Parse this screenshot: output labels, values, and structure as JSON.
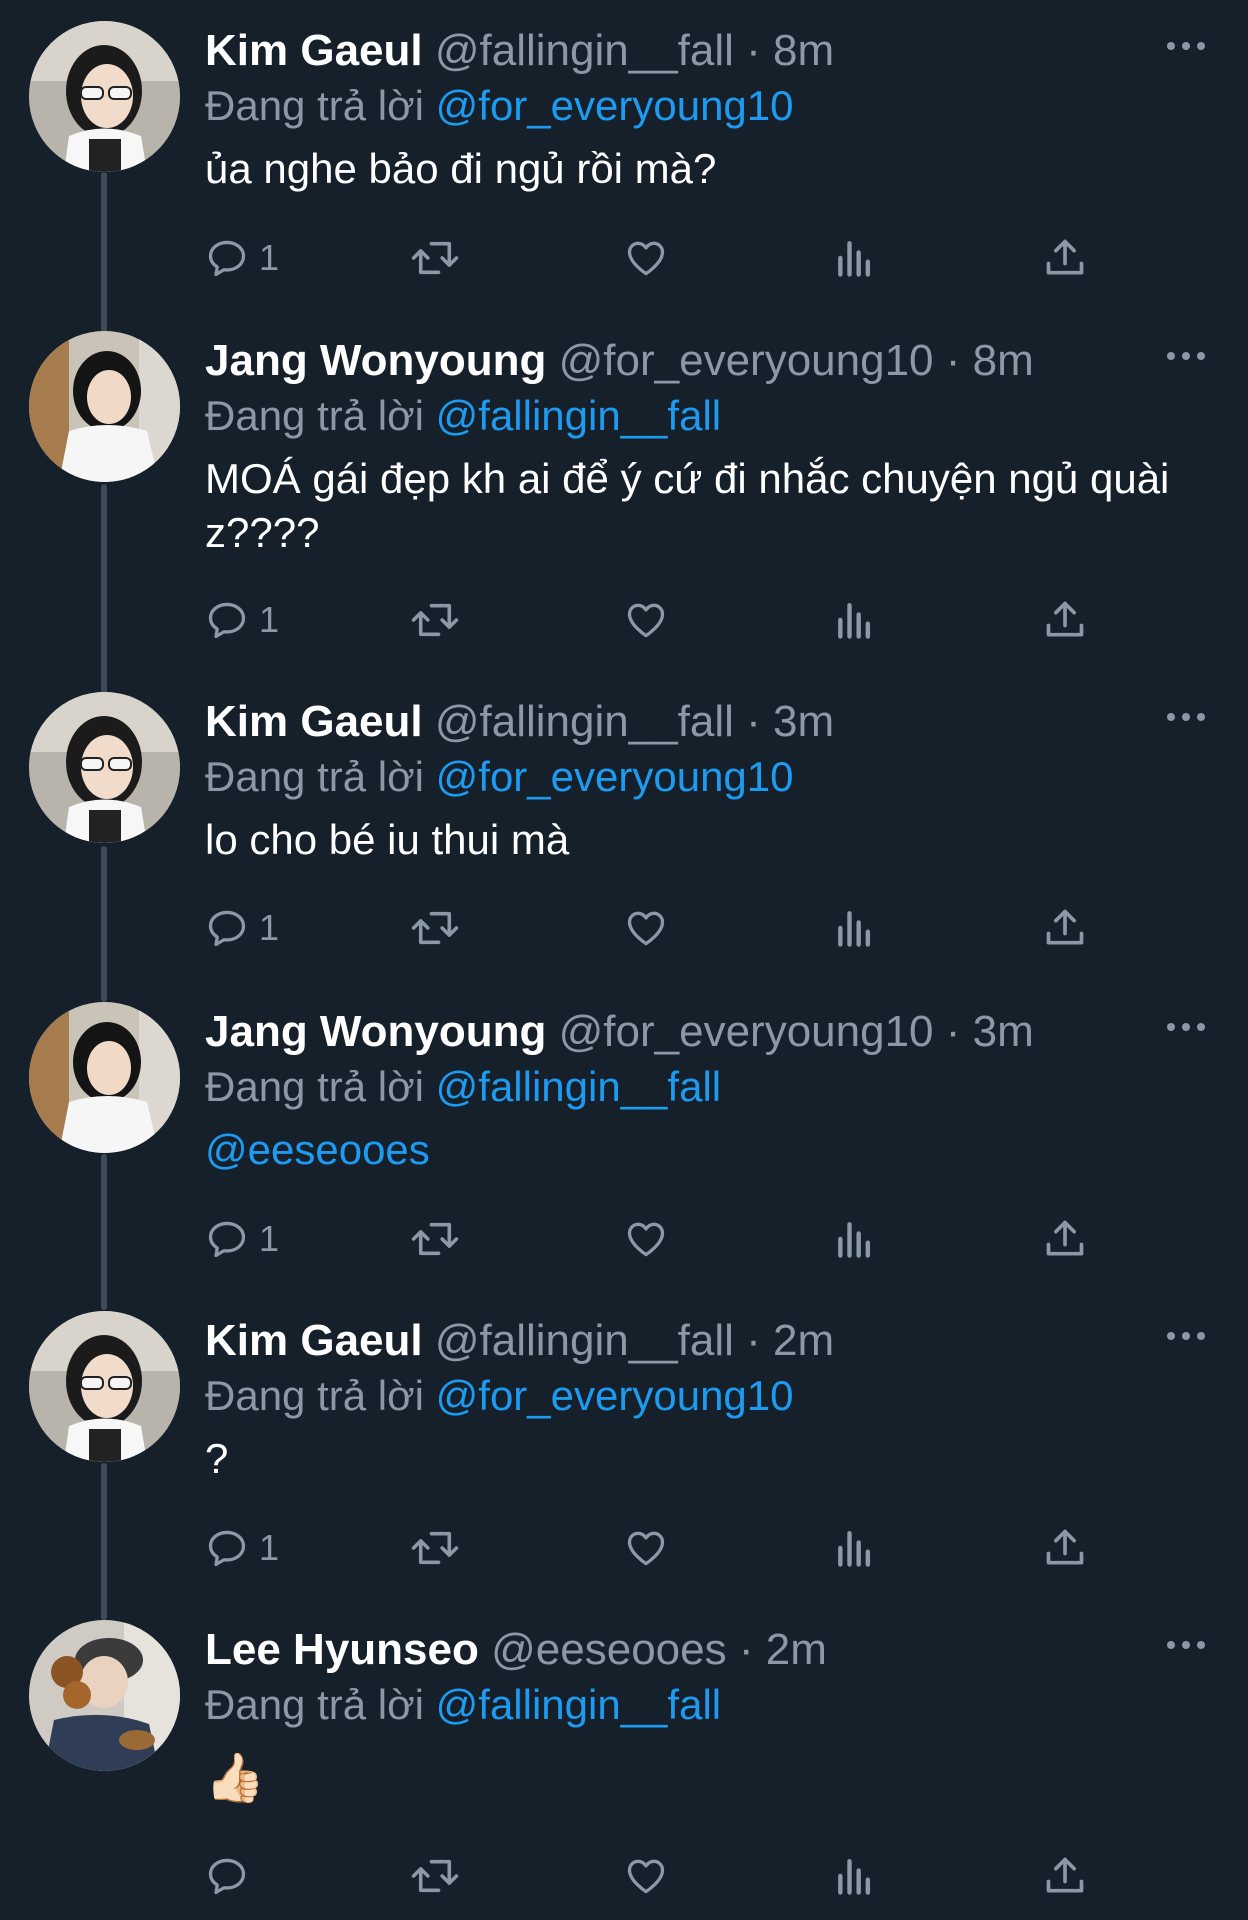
{
  "labels": {
    "replying_prefix": "Đang trả lời"
  },
  "tweets": [
    {
      "name": "Kim Gaeul",
      "handle": "@fallingin__fall",
      "time": "8m",
      "replying_to": "@for_everyoung10",
      "text": "ủa nghe bảo đi ngủ rồi mà?",
      "reply_count": "1"
    },
    {
      "name": "Jang Wonyoung",
      "handle": "@for_everyoung10",
      "time": "8m",
      "replying_to": "@fallingin__fall",
      "text": "MOÁ gái đẹp kh ai để ý cứ đi nhắc chuyện ngủ quài z????",
      "reply_count": "1"
    },
    {
      "name": "Kim Gaeul",
      "handle": "@fallingin__fall",
      "time": "3m",
      "replying_to": "@for_everyoung10",
      "text": "lo cho bé iu thui mà",
      "reply_count": "1"
    },
    {
      "name": "Jang Wonyoung",
      "handle": "@for_everyoung10",
      "time": "3m",
      "replying_to": "@fallingin__fall",
      "text": "@eeseooes",
      "reply_count": "1"
    },
    {
      "name": "Kim Gaeul",
      "handle": "@fallingin__fall",
      "time": "2m",
      "replying_to": "@for_everyoung10",
      "text": "?",
      "reply_count": "1"
    },
    {
      "name": "Lee Hyunseo",
      "handle": "@eeseooes",
      "time": "2m",
      "replying_to": "@fallingin__fall",
      "text": "👍🏻",
      "reply_count": ""
    }
  ],
  "separator": "·",
  "colors": {
    "background": "#15202b",
    "secondary_text": "#8b98a5",
    "mention": "#1d9bf0",
    "thread_line": "#3d4b58"
  },
  "icons": {
    "reply": "reply-icon",
    "retweet": "retweet-icon",
    "like": "heart-icon",
    "views": "views-icon",
    "share": "share-icon",
    "more": "more-icon"
  }
}
